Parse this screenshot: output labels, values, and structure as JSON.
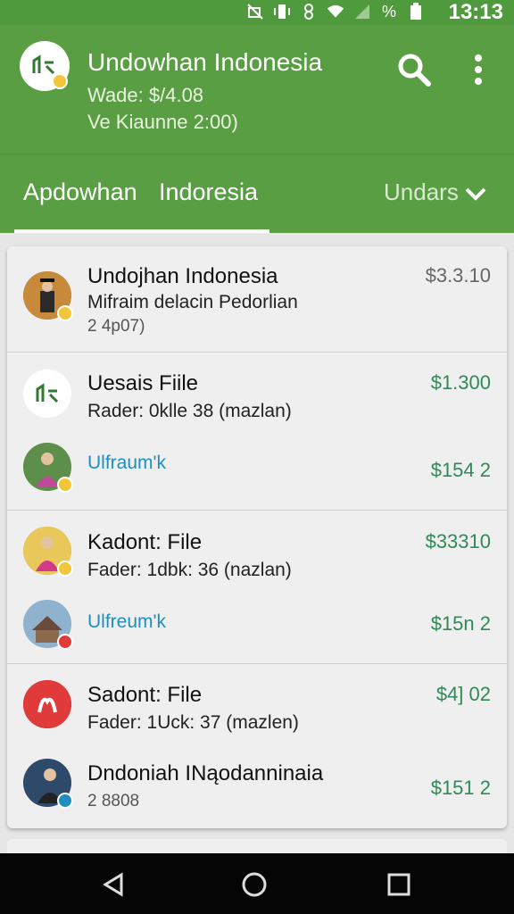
{
  "status_bar": {
    "time": "13:13",
    "icons": [
      "do-not-disturb-icon",
      "vibrate-icon",
      "data-icon",
      "wifi-icon",
      "signal-icon",
      "battery-icon"
    ],
    "percent_symbol": "%"
  },
  "header": {
    "title": "Undowhan Indonesia",
    "subtitle_1": "Wade: $/4.08",
    "subtitle_2": "Ve Kiaunne 2:00)",
    "icons": [
      "search-icon",
      "more-vert-icon"
    ]
  },
  "tabs": {
    "items": [
      "Apdowhan",
      "Indoresia",
      "Undars"
    ],
    "active_index": 0
  },
  "list": [
    {
      "title": "Undojhan Indonesia",
      "subtitle": "Mifraim delacin Pedorlian",
      "meta": "2 4p07)",
      "amount": "$3.3.10"
    },
    {
      "title": "Uesais Fiile",
      "subtitle": "Rader:  0klle 38  (mazlan)",
      "amount": "$1.300",
      "sub_link": "Ulfraum'k",
      "sub_amount": "$154 2"
    },
    {
      "title": "Kadont: File",
      "subtitle": "Fader:  1dbk: 36  (nazlan)",
      "amount": "$33310",
      "sub_link": "Ulfreum'k",
      "sub_amount": "$15n 2"
    },
    {
      "title": "Sadont: File",
      "subtitle": "Fader:  1Uck: 37  (mazlen)",
      "amount": "$4] 02",
      "sub_title": "Dndoniah INąodanninaia",
      "sub_meta": "2 8808",
      "sub_amount": "$151 2"
    }
  ],
  "colors": {
    "header_green": "#5a9e44",
    "amount_green": "#2f8a56",
    "link_blue": "#1f8fbf",
    "badge_yellow": "#f3c53b",
    "badge_red": "#e03a3a"
  },
  "nav": [
    "back-icon",
    "home-icon",
    "recents-icon"
  ]
}
